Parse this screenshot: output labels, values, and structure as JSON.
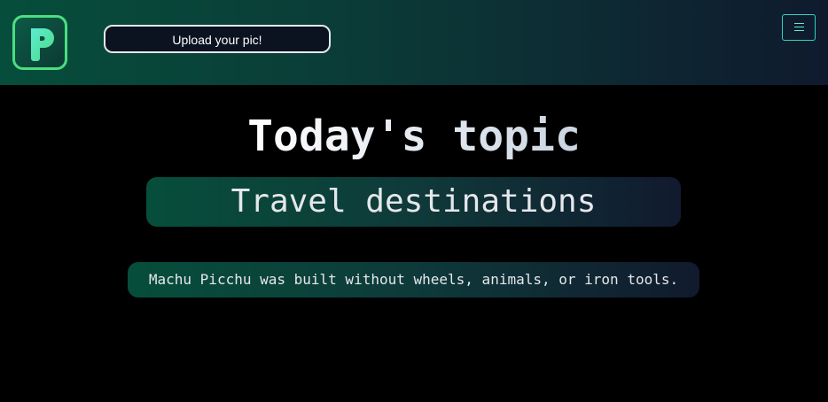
{
  "header": {
    "logo_icon": "letter-p-logo-icon",
    "upload_label": "Upload your pic!",
    "menu_icon": "hamburger-menu-icon"
  },
  "main": {
    "title": "Today's topic",
    "topic": "Travel destinations",
    "fact": "Machu Picchu was built without wheels, animals, or iron tools."
  },
  "colors": {
    "accent": "#4ade80",
    "header_gradient_start": "#064e3b",
    "header_gradient_end": "#0f1a2e",
    "menu_border": "#2dd4bf",
    "background": "#000000"
  }
}
